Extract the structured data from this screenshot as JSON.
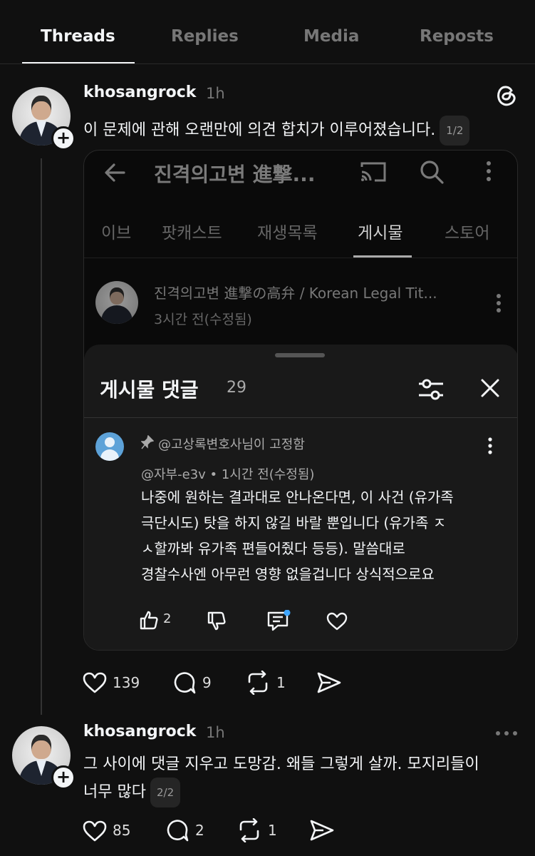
{
  "tabs": [
    {
      "label": "Threads",
      "active": true
    },
    {
      "label": "Replies",
      "active": false
    },
    {
      "label": "Media",
      "active": false
    },
    {
      "label": "Reposts",
      "active": false
    }
  ],
  "posts": [
    {
      "username": "khosangrock",
      "time": "1h",
      "text": "이 문제에 관해 오랜만에 의견 합치가 이루어졌습니다.",
      "page": "1/2",
      "stats": {
        "likes": "139",
        "replies": "9",
        "reposts": "1"
      },
      "embed": {
        "appbar_title": "진격의고변 進撃...",
        "subtabs": [
          "이브",
          "팟캐스트",
          "재생목록",
          "게시물",
          "스토어"
        ],
        "active_subtab": "게시물",
        "channel_name": "진격의고변 進撃の高弁 / Korean Legal Tit...",
        "channel_time": "3시간 전(수정됨)",
        "sheet": {
          "title": "게시물 댓글",
          "count": "29",
          "pinned": "@고상록변호사님이 고정함",
          "author": "@자부-e3v • 1시간 전(수정됨)",
          "comment_lines": [
            "나중에 원하는 결과대로 안나온다면, 이 사건 (유가족",
            "극단시도) 탓을 하지 않길 바랄 뿐입니다 (유가족 ㅈ",
            "ㅅ할까봐 유가족 편들어줬다 등등). 말씀대로",
            "경찰수사엔 아무런 영향 없을겁니다 상식적으로요"
          ],
          "like_count": "2"
        }
      }
    },
    {
      "username": "khosangrock",
      "time": "1h",
      "text_lines": [
        "그 사이에 댓글 지우고 도망감. 왜들 그렇게 살까. 모지리들이",
        "너무 많다"
      ],
      "page": "2/2",
      "stats": {
        "likes": "85",
        "replies": "2",
        "reposts": "1"
      }
    }
  ]
}
